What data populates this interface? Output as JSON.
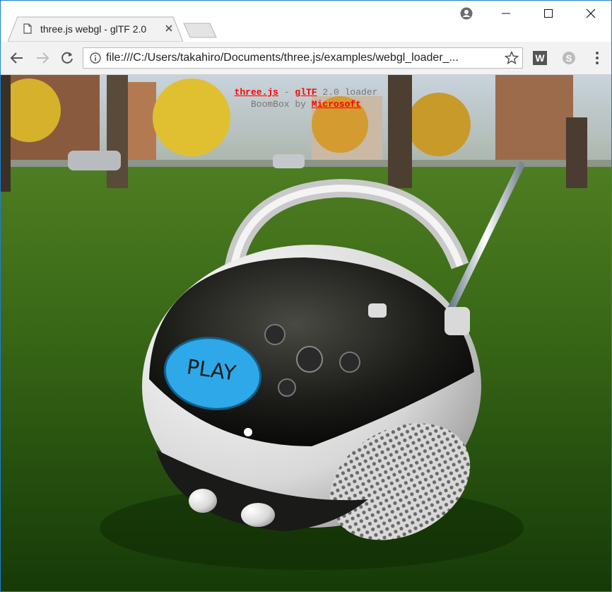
{
  "browser": {
    "tab_title": "three.js webgl - glTF 2.0",
    "address": "file:///C:/Users/takahiro/Documents/three.js/examples/webgl_loader_...",
    "extension_w_label": "W"
  },
  "info_overlay": {
    "line1_link1": "three.js",
    "line1_sep": " - ",
    "line1_link2": "glTF",
    "line1_rest": " 2.0 loader",
    "line2_text": "BoomBox by ",
    "line2_link": "Microsoft"
  },
  "scene": {
    "play_label": "PLAY"
  },
  "colors": {
    "window_border": "#1e7fd1",
    "link": "#ff0000",
    "play_button": "#2ea8e8",
    "grass": "#2f5a16"
  },
  "icons": [
    "page-icon",
    "close-icon",
    "new-tab-icon",
    "profile-icon",
    "minimize-icon",
    "maximize-icon",
    "window-close-icon",
    "back-arrow-icon",
    "forward-arrow-icon",
    "reload-icon",
    "info-icon",
    "star-icon",
    "w-extension-icon",
    "skype-icon",
    "menu-icon"
  ]
}
